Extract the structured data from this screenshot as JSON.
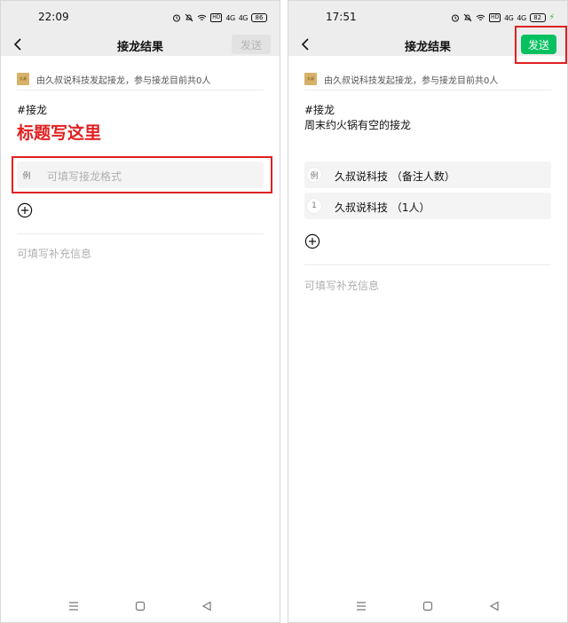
{
  "left": {
    "status": {
      "time": "22:09",
      "hd": "HD",
      "signal1": "4G",
      "signal2": "4G",
      "battery": "86"
    },
    "nav": {
      "title": "接龙结果",
      "send_label": "发送"
    },
    "initiator": {
      "avatar_text": "久叔",
      "text": "由久叔说科技发起接龙，参与接龙目前共0人"
    },
    "hashtag": "#接龙",
    "title_annotation": "标题写这里",
    "entries": [
      {
        "index": "例",
        "placeholder": "可填写接龙格式"
      }
    ],
    "supplement_placeholder": "可填写补充信息"
  },
  "right": {
    "status": {
      "time": "17:51",
      "hd": "HD",
      "signal1": "4G",
      "signal2": "4G",
      "battery": "82"
    },
    "nav": {
      "title": "接龙结果",
      "send_label": "发送"
    },
    "initiator": {
      "avatar_text": "久叔",
      "text": "由久叔说科技发起接龙，参与接龙目前共0人"
    },
    "hashtag": "#接龙",
    "title": "周末约火锅有空的接龙",
    "entries": [
      {
        "index": "例",
        "text": "久叔说科技 （备注人数）"
      },
      {
        "index": "1",
        "text": "久叔说科技 （1人）"
      }
    ],
    "supplement_placeholder": "可填写补充信息"
  },
  "colors": {
    "accent_green": "#07c160",
    "annotation_red": "#e02020",
    "bar_gray": "#ededed"
  }
}
